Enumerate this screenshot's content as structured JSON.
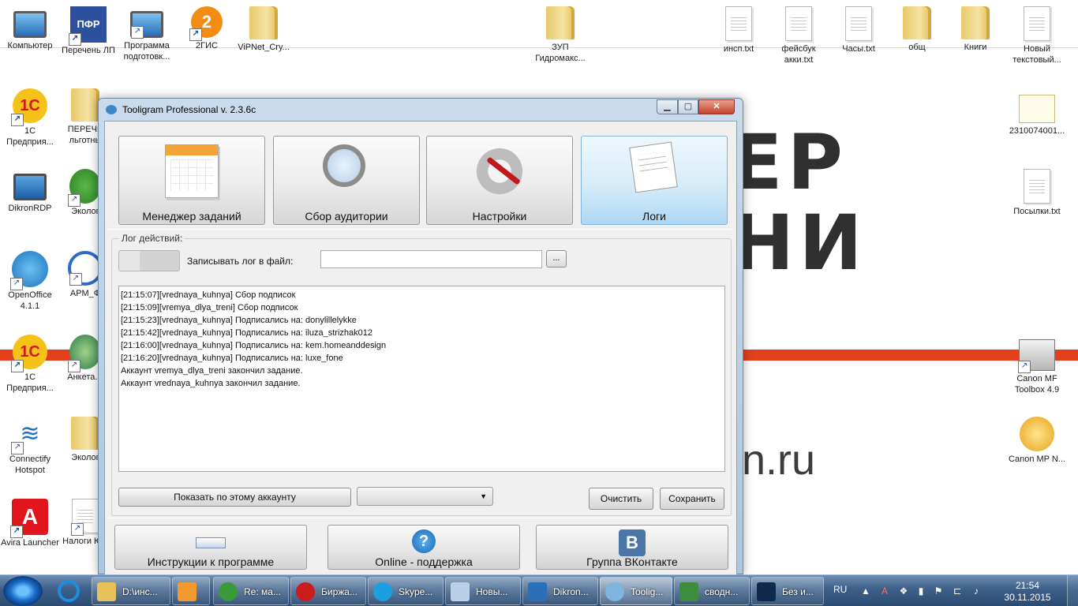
{
  "wallpaper": {
    "big_line1": "ЕР",
    "big_line2": "НИ",
    "site": "n.ru"
  },
  "desktop_icons": [
    {
      "label": "Компьютер",
      "icon": "computer-icon"
    },
    {
      "label": "Перечень ЛП",
      "icon": "pfr-icon"
    },
    {
      "label": "Программа подготовк...",
      "icon": "computer-icon"
    },
    {
      "label": "2ГИС",
      "icon": "2gis-icon"
    },
    {
      "label": "ViPNet_Cry...",
      "icon": "folder-icon"
    },
    {
      "label": "ЗУП Гидромакс...",
      "icon": "folder-icon"
    },
    {
      "label": "инсп.txt",
      "icon": "text-file-icon"
    },
    {
      "label": "фейсбук акки.txt",
      "icon": "text-file-icon"
    },
    {
      "label": "Часы.txt",
      "icon": "text-file-icon"
    },
    {
      "label": "общ",
      "icon": "folder-icon"
    },
    {
      "label": "Книги",
      "icon": "folder-icon"
    },
    {
      "label": "Новый текстовый...",
      "icon": "text-file-icon"
    },
    {
      "label": "1С Предприя...",
      "icon": "1c-icon"
    },
    {
      "label": "ПЕРЕЧЕ льготны",
      "icon": "folder-icon"
    },
    {
      "label": "2310074001...",
      "icon": "certificate-icon"
    },
    {
      "label": "DikronRDP",
      "icon": "rdp-icon"
    },
    {
      "label": "Эколог",
      "icon": "tree-icon"
    },
    {
      "label": "Посылки.txt",
      "icon": "text-file-icon"
    },
    {
      "label": "OpenOffice 4.1.1",
      "icon": "openoffice-icon"
    },
    {
      "label": "АРМ_Ф",
      "icon": "arm-icon"
    },
    {
      "label": "1С Предприя...",
      "icon": "1c-icon"
    },
    {
      "label": "Анкета.Р",
      "icon": "form-icon"
    },
    {
      "label": "Canon MF Toolbox 4.9",
      "icon": "printer-icon"
    },
    {
      "label": "Connectify Hotspot",
      "icon": "wifi-icon"
    },
    {
      "label": "Эколог",
      "icon": "folder-icon"
    },
    {
      "label": "Canon MP N...",
      "icon": "canon-icon"
    },
    {
      "label": "Avira Launcher",
      "icon": "avira-icon"
    },
    {
      "label": "Налоги ЮЛ",
      "icon": "tax-icon"
    }
  ],
  "window": {
    "title": "Tooligram Professional v. 2.3.6c",
    "min": "▁",
    "max": "▢",
    "close": "✕"
  },
  "tabs": [
    {
      "label": "Менеджер заданий",
      "icon": "task-calendar-icon"
    },
    {
      "label": "Сбор аудитории",
      "icon": "audience-search-icon"
    },
    {
      "label": "Настройки",
      "icon": "settings-gear-icon"
    },
    {
      "label": "Логи",
      "icon": "logs-icon"
    }
  ],
  "log_panel": {
    "group_title": "Лог действий:",
    "write_to_file_label": "Записывать лог в файл:",
    "file_path": "",
    "browse_label": "...",
    "lines": [
      "[21:15:07][vrednaya_kuhnya] Сбор подписок",
      "[21:15:09][vremya_dlya_treni] Сбор подписок",
      "[21:15:23][vrednaya_kuhnya] Подписались на: donylillelykke",
      "[21:15:42][vrednaya_kuhnya] Подписались на: iluza_strizhak012",
      "[21:16:00][vrednaya_kuhnya] Подписались на: kem.homeanddesign",
      "[21:16:20][vrednaya_kuhnya] Подписались на: luxe_fone",
      "Аккаунт vremya_dlya_treni закончил задание.",
      "Аккаунт vrednaya_kuhnya закончил задание."
    ],
    "show_by_account_label": "Показать по этому аккаунту",
    "account_select_value": "",
    "clear_label": "Очистить",
    "save_label": "Сохранить"
  },
  "bottom_buttons": {
    "instructions": "Инструкции к программе",
    "online_support": "Online - поддержка",
    "vk_group": "Группа ВКонтакте"
  },
  "taskbar": {
    "items": [
      {
        "label": "D:\\инс...",
        "icon": "folder-icon",
        "color": "#e8c15a"
      },
      {
        "label": "Re: ма...",
        "icon": "chrome-icon",
        "color": "#3a9a3a"
      },
      {
        "label": "Биржа...",
        "icon": "opera-icon",
        "color": "#cc1b1b"
      },
      {
        "label": "Skype...",
        "icon": "skype-icon",
        "color": "#1aa0e0"
      },
      {
        "label": "Новы...",
        "icon": "notepad-icon",
        "color": "#b9d0e8"
      },
      {
        "label": "Dikron...",
        "icon": "rdp-icon",
        "color": "#2a6fb8"
      },
      {
        "label": "Toolig...",
        "icon": "tooligram-icon",
        "color": "#7fb6e0"
      },
      {
        "label": "сводн...",
        "icon": "spreadsheet-icon",
        "color": "#3f8c3f"
      },
      {
        "label": "Без и...",
        "icon": "photoshop-icon",
        "color": "#0f2a4d"
      }
    ],
    "lang": "RU",
    "time": "21:54",
    "date": "30.11.2015"
  }
}
